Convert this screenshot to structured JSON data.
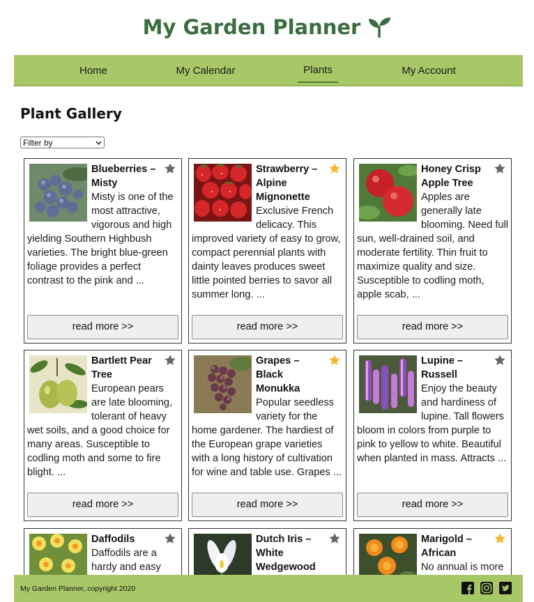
{
  "header": {
    "title": "My Garden Planner",
    "logo_icon": "sprout-icon"
  },
  "nav": {
    "items": [
      {
        "label": "Home",
        "active": false
      },
      {
        "label": "My Calendar",
        "active": false
      },
      {
        "label": "Plants",
        "active": true
      },
      {
        "label": "My Account",
        "active": false
      }
    ]
  },
  "gallery": {
    "title": "Plant Gallery",
    "filter": {
      "selected": "Filter by"
    },
    "read_more_label": "read more >>",
    "cards": [
      {
        "name": "Blueberries – Misty",
        "favorite": false,
        "text": "Misty is one of the most attractive, vigorous and high yielding Southern Highbush varieties. The bright blue-green foliage provides a perfect contrast to the pink and ..."
      },
      {
        "name": "Strawberry – Alpine Mignonette",
        "favorite": true,
        "text": "Exclusive French delicacy. This improved variety of easy to grow, compact perennial plants with dainty leaves produces sweet little pointed berries to savor all summer long. ..."
      },
      {
        "name": "Honey Crisp Apple Tree",
        "favorite": false,
        "text": "Apples are generally late blooming. Need full sun, well-drained soil, and moderate fertility. Thin fruit to maximize quality and size. Susceptible to codling moth, apple scab, ..."
      },
      {
        "name": "Bartlett Pear Tree",
        "favorite": false,
        "text": "European pears are late blooming, tolerant of heavy wet soils, and a good choice for many areas. Susceptible to codling moth and some to fire blight. ..."
      },
      {
        "name": "Grapes – Black Monukka",
        "favorite": true,
        "text": "Popular seedless variety for the home gardener. The hardiest of the European grape varieties with a long history of cultivation for wine and table use. Grapes ..."
      },
      {
        "name": "Lupine – Russell",
        "favorite": false,
        "text": "Enjoy the beauty and hardiness of lupine. Tall flowers bloom in colors from purple to pink to yellow to white. Beautiful when planted in mass. Attracts ..."
      },
      {
        "name": "Daffodils",
        "favorite": false,
        "text": "Daffodils are a hardy and easy"
      },
      {
        "name": "Dutch Iris – White Wedgewood",
        "favorite": false,
        "text": ""
      },
      {
        "name": "Marigold – African",
        "favorite": true,
        "text": "No annual is more"
      }
    ]
  },
  "footer": {
    "copyright": "My Garden Planner, copyright 2020",
    "social": [
      "facebook-icon",
      "instagram-icon",
      "twitter-icon"
    ]
  },
  "colors": {
    "brand_green": "#3a6e3f",
    "nav_bg": "#a8c766",
    "star_active": "#f5b82e",
    "star_inactive": "#666666"
  }
}
